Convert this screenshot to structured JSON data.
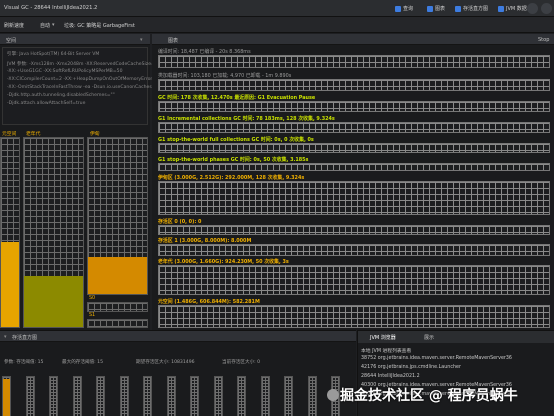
{
  "window": {
    "title": "Visual GC - 28644 IntelliJIdea2021.2",
    "checkboxes": [
      "查询",
      "图表",
      "存活直方图",
      "JVM 数据"
    ]
  },
  "toolbar": {
    "refresh_label": "刷新速度",
    "refresh_value": "自动",
    "gc_label": "垃圾: GC 策略是 GarbageFirst"
  },
  "spaces": {
    "header": "空间",
    "info_lines": [
      "引擎: Java HotSpot(TM) 64-Bit Server VM",
      "JVM 参数: -Xms128m -Xmx2048m -XX:ReservedCodeCacheSize=512m",
      "   -XX:+UseG1GC -XX:SoftRefLRUPolicyMSPerMB=50",
      "   -XX:CICompilerCount=2 -XX:+HeapDumpOnOutOfMemoryError",
      "   -XX:-OmitStackTraceInFastThrow -ea -Dsun.io.useCanonCaches=false",
      "   -Djdk.http.auth.tunneling.disabledSchemes=\"\"",
      "   -Djdk.attach.allowAttachSelf=true"
    ],
    "columns": [
      {
        "label": "元空间",
        "fills": [
          {
            "level": 0.45,
            "color": "#e6a400"
          }
        ]
      },
      {
        "label": "老年代",
        "fills": [
          {
            "level": 0.27,
            "color": "#8c8a00"
          }
        ]
      },
      {
        "label": "伊甸",
        "fills": [
          {
            "level": 0.24,
            "color": "#d48a00"
          },
          {
            "level": 0.05,
            "color": "#e6a400"
          }
        ]
      }
    ],
    "surv_labels": [
      "S0",
      "S1"
    ]
  },
  "graphs": {
    "header": "图表",
    "stop_label": "Stop",
    "rows": [
      {
        "text": "编译时间: 18,487 已编译 - 20s 8.368ms",
        "style": "dim"
      },
      {
        "text": "类加载器时间: 103,180 已加载; 4,970 已卸载 - 1m 9.890s",
        "style": "dim"
      },
      {
        "text": "GC 时间: 178 次收集, 12.470s 最近原因: G1 Evacuation Pause",
        "style": "g"
      },
      {
        "text": "G1 Incremental collections GC 时间: 78 183ms, 128 次收集, 9.324s",
        "style": "g"
      },
      {
        "text": "G1 stop-the-world full collections GC 时间: 0s, 0 次收集, 0s",
        "style": "g"
      },
      {
        "text": "G1 stop-the-world phases GC 时间: 0s, 50 次收集, 3.185s",
        "style": "g"
      },
      {
        "text": "伊甸区 (3.000G, 2.512G): 292.000M, 128 次收集, 9.324s",
        "style": "y"
      },
      {
        "text": "存活区 0 (0, 0): 0",
        "style": "y"
      },
      {
        "text": "存活区 1 (3.000G, 8.000M): 8.000M",
        "style": "y"
      },
      {
        "text": "老年代 (3.000G, 1.660G): 924.230M, 50 次收集, 3s",
        "style": "y"
      },
      {
        "text": "元空间 (1.486G, 606.844M): 582.281M",
        "style": "y"
      }
    ]
  },
  "histogram": {
    "header": "存活直方图",
    "stats": [
      "参数: 存活阈值: 15",
      "最大的存活阈值: 15",
      "期望存活区大小: 10831496",
      "当前存活区大小: 0"
    ],
    "cells": [
      {
        "level": 0.95,
        "color": "#d48a00"
      },
      {
        "level": 0.0,
        "color": "#d48a00"
      },
      {
        "level": 0.0,
        "color": "#d48a00"
      },
      {
        "level": 0.0,
        "color": "#d48a00"
      },
      {
        "level": 0.0,
        "color": "#d48a00"
      },
      {
        "level": 0.0,
        "color": "#d48a00"
      },
      {
        "level": 0.0,
        "color": "#d48a00"
      },
      {
        "level": 0.0,
        "color": "#d48a00"
      },
      {
        "level": 0.0,
        "color": "#d48a00"
      },
      {
        "level": 0.0,
        "color": "#d48a00"
      },
      {
        "level": 0.0,
        "color": "#d48a00"
      },
      {
        "level": 0.0,
        "color": "#d48a00"
      },
      {
        "level": 0.0,
        "color": "#d48a00"
      },
      {
        "level": 0.0,
        "color": "#d48a00"
      },
      {
        "level": 0.0,
        "color": "#d48a00"
      }
    ]
  },
  "jvm": {
    "tabs": [
      "JVM 浏览器",
      "展示"
    ],
    "header": "本地 JVM 进程列表查看",
    "processes": [
      "38752 org.jetbrains.idea.maven.server.RemoteMavenServer36",
      "42176 org.jetbrains.jps.cmdline.Launcher",
      "28644 IntelliJIdea2021.2",
      "40300 org.jetbrains.idea.maven.server.RemoteMavenServer36",
      "43076 org.jetbrains.idea.maven.server.RemoteMavenServer36"
    ]
  },
  "watermark": "掘金技术社区 @ 程序员蜗牛"
}
